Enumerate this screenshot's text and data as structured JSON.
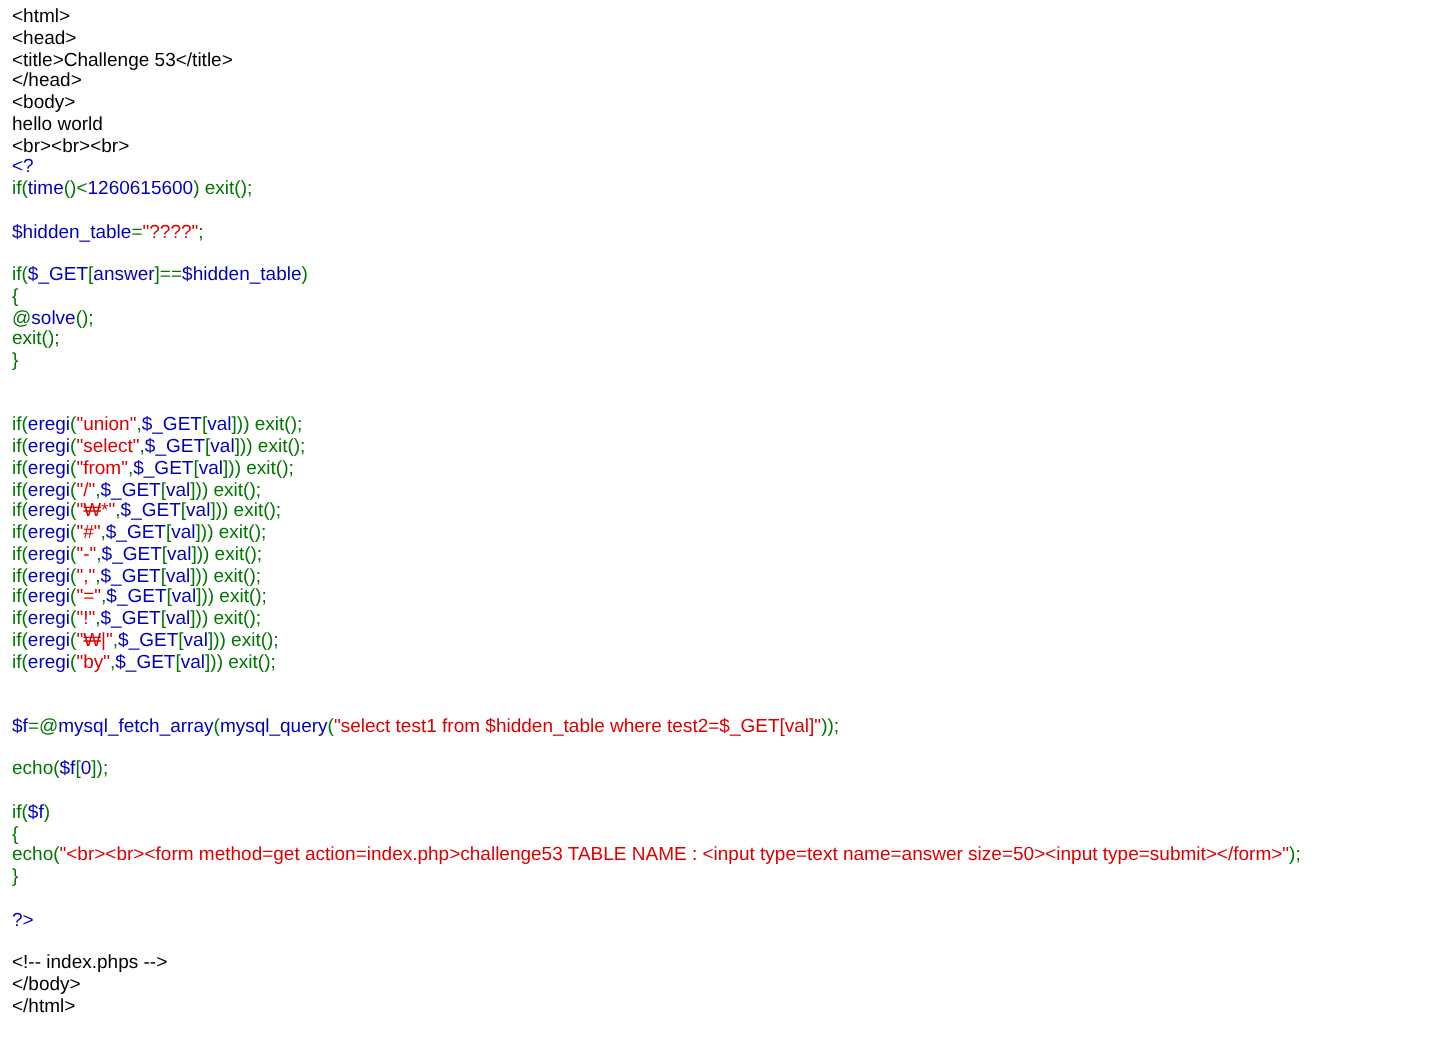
{
  "lines": [
    {
      "kind": "code",
      "tokens": [
        {
          "kind": "html",
          "text": "<html>"
        }
      ]
    },
    {
      "kind": "code",
      "tokens": [
        {
          "kind": "html",
          "text": "<head>"
        }
      ]
    },
    {
      "kind": "code",
      "tokens": [
        {
          "kind": "html",
          "text": "<title>Challenge 53</title>"
        }
      ]
    },
    {
      "kind": "code",
      "tokens": [
        {
          "kind": "html",
          "text": "</head>"
        }
      ]
    },
    {
      "kind": "code",
      "tokens": [
        {
          "kind": "html",
          "text": "<body>"
        }
      ]
    },
    {
      "kind": "code",
      "tokens": [
        {
          "kind": "html",
          "text": "hello world"
        }
      ]
    },
    {
      "kind": "code",
      "tokens": [
        {
          "kind": "html",
          "text": "<br><br><br>"
        }
      ]
    },
    {
      "kind": "code",
      "tokens": [
        {
          "kind": "default",
          "text": "<?"
        }
      ]
    },
    {
      "kind": "code",
      "tokens": [
        {
          "kind": "keyword",
          "text": "if("
        },
        {
          "kind": "default",
          "text": "time"
        },
        {
          "kind": "keyword",
          "text": "()<"
        },
        {
          "kind": "default",
          "text": "1260615600"
        },
        {
          "kind": "keyword",
          "text": ") exit();"
        }
      ]
    },
    {
      "kind": "blank"
    },
    {
      "kind": "code",
      "tokens": [
        {
          "kind": "default",
          "text": "$hidden_table"
        },
        {
          "kind": "keyword",
          "text": "="
        },
        {
          "kind": "string",
          "text": "\"????\""
        },
        {
          "kind": "keyword",
          "text": ";"
        }
      ]
    },
    {
      "kind": "blank"
    },
    {
      "kind": "code",
      "tokens": [
        {
          "kind": "keyword",
          "text": "if("
        },
        {
          "kind": "default",
          "text": "$_GET"
        },
        {
          "kind": "keyword",
          "text": "["
        },
        {
          "kind": "default",
          "text": "answer"
        },
        {
          "kind": "keyword",
          "text": "]=="
        },
        {
          "kind": "default",
          "text": "$hidden_table"
        },
        {
          "kind": "keyword",
          "text": ")"
        }
      ]
    },
    {
      "kind": "code",
      "tokens": [
        {
          "kind": "keyword",
          "text": "{"
        }
      ]
    },
    {
      "kind": "code",
      "tokens": [
        {
          "kind": "keyword",
          "text": "@"
        },
        {
          "kind": "default",
          "text": "solve"
        },
        {
          "kind": "keyword",
          "text": "();"
        }
      ]
    },
    {
      "kind": "code",
      "tokens": [
        {
          "kind": "keyword",
          "text": "exit();"
        }
      ]
    },
    {
      "kind": "code",
      "tokens": [
        {
          "kind": "keyword",
          "text": "}"
        }
      ]
    },
    {
      "kind": "blank"
    },
    {
      "kind": "blank"
    },
    {
      "kind": "code",
      "tokens": [
        {
          "kind": "keyword",
          "text": "if("
        },
        {
          "kind": "default",
          "text": "eregi"
        },
        {
          "kind": "keyword",
          "text": "("
        },
        {
          "kind": "string",
          "text": "\"union\""
        },
        {
          "kind": "keyword",
          "text": ","
        },
        {
          "kind": "default",
          "text": "$_GET"
        },
        {
          "kind": "keyword",
          "text": "["
        },
        {
          "kind": "default",
          "text": "val"
        },
        {
          "kind": "keyword",
          "text": "])) exit();"
        }
      ]
    },
    {
      "kind": "code",
      "tokens": [
        {
          "kind": "keyword",
          "text": "if("
        },
        {
          "kind": "default",
          "text": "eregi"
        },
        {
          "kind": "keyword",
          "text": "("
        },
        {
          "kind": "string",
          "text": "\"select\""
        },
        {
          "kind": "keyword",
          "text": ","
        },
        {
          "kind": "default",
          "text": "$_GET"
        },
        {
          "kind": "keyword",
          "text": "["
        },
        {
          "kind": "default",
          "text": "val"
        },
        {
          "kind": "keyword",
          "text": "])) exit();"
        }
      ]
    },
    {
      "kind": "code",
      "tokens": [
        {
          "kind": "keyword",
          "text": "if("
        },
        {
          "kind": "default",
          "text": "eregi"
        },
        {
          "kind": "keyword",
          "text": "("
        },
        {
          "kind": "string",
          "text": "\"from\""
        },
        {
          "kind": "keyword",
          "text": ","
        },
        {
          "kind": "default",
          "text": "$_GET"
        },
        {
          "kind": "keyword",
          "text": "["
        },
        {
          "kind": "default",
          "text": "val"
        },
        {
          "kind": "keyword",
          "text": "])) exit();"
        }
      ]
    },
    {
      "kind": "code",
      "tokens": [
        {
          "kind": "keyword",
          "text": "if("
        },
        {
          "kind": "default",
          "text": "eregi"
        },
        {
          "kind": "keyword",
          "text": "("
        },
        {
          "kind": "string",
          "text": "\"/\""
        },
        {
          "kind": "keyword",
          "text": ","
        },
        {
          "kind": "default",
          "text": "$_GET"
        },
        {
          "kind": "keyword",
          "text": "["
        },
        {
          "kind": "default",
          "text": "val"
        },
        {
          "kind": "keyword",
          "text": "])) exit();"
        }
      ]
    },
    {
      "kind": "code",
      "tokens": [
        {
          "kind": "keyword",
          "text": "if("
        },
        {
          "kind": "default",
          "text": "eregi"
        },
        {
          "kind": "keyword",
          "text": "("
        },
        {
          "kind": "string",
          "text": "\"₩*\""
        },
        {
          "kind": "keyword",
          "text": ","
        },
        {
          "kind": "default",
          "text": "$_GET"
        },
        {
          "kind": "keyword",
          "text": "["
        },
        {
          "kind": "default",
          "text": "val"
        },
        {
          "kind": "keyword",
          "text": "])) exit();"
        }
      ]
    },
    {
      "kind": "code",
      "tokens": [
        {
          "kind": "keyword",
          "text": "if("
        },
        {
          "kind": "default",
          "text": "eregi"
        },
        {
          "kind": "keyword",
          "text": "("
        },
        {
          "kind": "string",
          "text": "\"#\""
        },
        {
          "kind": "keyword",
          "text": ","
        },
        {
          "kind": "default",
          "text": "$_GET"
        },
        {
          "kind": "keyword",
          "text": "["
        },
        {
          "kind": "default",
          "text": "val"
        },
        {
          "kind": "keyword",
          "text": "])) exit();"
        }
      ]
    },
    {
      "kind": "code",
      "tokens": [
        {
          "kind": "keyword",
          "text": "if("
        },
        {
          "kind": "default",
          "text": "eregi"
        },
        {
          "kind": "keyword",
          "text": "("
        },
        {
          "kind": "string",
          "text": "\"-\""
        },
        {
          "kind": "keyword",
          "text": ","
        },
        {
          "kind": "default",
          "text": "$_GET"
        },
        {
          "kind": "keyword",
          "text": "["
        },
        {
          "kind": "default",
          "text": "val"
        },
        {
          "kind": "keyword",
          "text": "])) exit();"
        }
      ]
    },
    {
      "kind": "code",
      "tokens": [
        {
          "kind": "keyword",
          "text": "if("
        },
        {
          "kind": "default",
          "text": "eregi"
        },
        {
          "kind": "keyword",
          "text": "("
        },
        {
          "kind": "string",
          "text": "\",\""
        },
        {
          "kind": "keyword",
          "text": ","
        },
        {
          "kind": "default",
          "text": "$_GET"
        },
        {
          "kind": "keyword",
          "text": "["
        },
        {
          "kind": "default",
          "text": "val"
        },
        {
          "kind": "keyword",
          "text": "])) exit();"
        }
      ]
    },
    {
      "kind": "code",
      "tokens": [
        {
          "kind": "keyword",
          "text": "if("
        },
        {
          "kind": "default",
          "text": "eregi"
        },
        {
          "kind": "keyword",
          "text": "("
        },
        {
          "kind": "string",
          "text": "\"=\""
        },
        {
          "kind": "keyword",
          "text": ","
        },
        {
          "kind": "default",
          "text": "$_GET"
        },
        {
          "kind": "keyword",
          "text": "["
        },
        {
          "kind": "default",
          "text": "val"
        },
        {
          "kind": "keyword",
          "text": "])) exit();"
        }
      ]
    },
    {
      "kind": "code",
      "tokens": [
        {
          "kind": "keyword",
          "text": "if("
        },
        {
          "kind": "default",
          "text": "eregi"
        },
        {
          "kind": "keyword",
          "text": "("
        },
        {
          "kind": "string",
          "text": "\"!\""
        },
        {
          "kind": "keyword",
          "text": ","
        },
        {
          "kind": "default",
          "text": "$_GET"
        },
        {
          "kind": "keyword",
          "text": "["
        },
        {
          "kind": "default",
          "text": "val"
        },
        {
          "kind": "keyword",
          "text": "])) exit();"
        }
      ]
    },
    {
      "kind": "code",
      "tokens": [
        {
          "kind": "keyword",
          "text": "if("
        },
        {
          "kind": "default",
          "text": "eregi"
        },
        {
          "kind": "keyword",
          "text": "("
        },
        {
          "kind": "string",
          "text": "\"₩|\""
        },
        {
          "kind": "keyword",
          "text": ","
        },
        {
          "kind": "default",
          "text": "$_GET"
        },
        {
          "kind": "keyword",
          "text": "["
        },
        {
          "kind": "default",
          "text": "val"
        },
        {
          "kind": "keyword",
          "text": "])) exit();"
        }
      ]
    },
    {
      "kind": "code",
      "tokens": [
        {
          "kind": "keyword",
          "text": "if("
        },
        {
          "kind": "default",
          "text": "eregi"
        },
        {
          "kind": "keyword",
          "text": "("
        },
        {
          "kind": "string",
          "text": "\"by\""
        },
        {
          "kind": "keyword",
          "text": ","
        },
        {
          "kind": "default",
          "text": "$_GET"
        },
        {
          "kind": "keyword",
          "text": "["
        },
        {
          "kind": "default",
          "text": "val"
        },
        {
          "kind": "keyword",
          "text": "])) exit();"
        }
      ]
    },
    {
      "kind": "blank"
    },
    {
      "kind": "blank"
    },
    {
      "kind": "code",
      "tokens": [
        {
          "kind": "default",
          "text": "$f"
        },
        {
          "kind": "keyword",
          "text": "=@"
        },
        {
          "kind": "default",
          "text": "mysql_fetch_array"
        },
        {
          "kind": "keyword",
          "text": "("
        },
        {
          "kind": "default",
          "text": "mysql_query"
        },
        {
          "kind": "keyword",
          "text": "("
        },
        {
          "kind": "string",
          "text": "\"select test1 from $hidden_table where test2=$_GET[val]\""
        },
        {
          "kind": "keyword",
          "text": "));"
        }
      ]
    },
    {
      "kind": "blank"
    },
    {
      "kind": "code",
      "tokens": [
        {
          "kind": "keyword",
          "text": "echo("
        },
        {
          "kind": "default",
          "text": "$f"
        },
        {
          "kind": "keyword",
          "text": "["
        },
        {
          "kind": "default",
          "text": "0"
        },
        {
          "kind": "keyword",
          "text": "]);"
        }
      ]
    },
    {
      "kind": "blank"
    },
    {
      "kind": "code",
      "tokens": [
        {
          "kind": "keyword",
          "text": "if("
        },
        {
          "kind": "default",
          "text": "$f"
        },
        {
          "kind": "keyword",
          "text": ")"
        }
      ]
    },
    {
      "kind": "code",
      "tokens": [
        {
          "kind": "keyword",
          "text": "{"
        }
      ]
    },
    {
      "kind": "code",
      "tokens": [
        {
          "kind": "keyword",
          "text": "echo("
        },
        {
          "kind": "string",
          "text": "\"<br><br><form method=get action=index.php>challenge53 TABLE NAME : <input type=text name=answer size=50><input type=submit></form>\""
        },
        {
          "kind": "keyword",
          "text": ");"
        }
      ]
    },
    {
      "kind": "code",
      "tokens": [
        {
          "kind": "keyword",
          "text": "}"
        }
      ]
    },
    {
      "kind": "blank"
    },
    {
      "kind": "code",
      "tokens": [
        {
          "kind": "default",
          "text": "?>"
        }
      ]
    },
    {
      "kind": "blank"
    },
    {
      "kind": "code",
      "tokens": [
        {
          "kind": "html",
          "text": "<!-- index.phps -->"
        }
      ]
    },
    {
      "kind": "code",
      "tokens": [
        {
          "kind": "html",
          "text": "</body>"
        }
      ]
    },
    {
      "kind": "code",
      "tokens": [
        {
          "kind": "html",
          "text": "</html>"
        }
      ]
    }
  ]
}
